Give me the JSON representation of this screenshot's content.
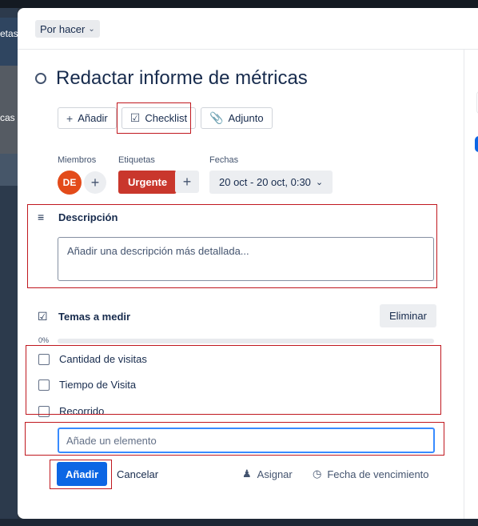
{
  "background": {
    "left_texts": [
      "etas",
      "cas"
    ]
  },
  "header": {
    "list_name": "Por hacer"
  },
  "card": {
    "title": "Redactar informe de métricas",
    "actions": [
      {
        "label": "Añadir",
        "icon": "plus-icon"
      },
      {
        "label": "Checklist",
        "icon": "checklist-icon"
      },
      {
        "label": "Adjunto",
        "icon": "paperclip-icon"
      }
    ]
  },
  "meta": {
    "members_label": "Miembros",
    "member_initials": "DE",
    "labels_label": "Etiquetas",
    "label_text": "Urgente",
    "label_color": "#c9372c",
    "dates_label": "Fechas",
    "date_value": "20 oct - 20 oct, 0:30"
  },
  "description": {
    "title": "Descripción",
    "placeholder": "Añadir una descripción más detallada..."
  },
  "checklist": {
    "title": "Temas a medir",
    "delete_label": "Eliminar",
    "progress_text": "0%",
    "progress": 0,
    "items": [
      "Cantidad de visitas",
      "Tiempo de Visita",
      "Recorrido"
    ],
    "new_item_placeholder": "Añade un elemento",
    "add_label": "Añadir",
    "cancel_label": "Cancelar",
    "assign_label": "Asignar",
    "due_label": "Fecha de vencimiento"
  },
  "colors": {
    "primary": "#0c66e4",
    "highlight": "#c0181f"
  }
}
